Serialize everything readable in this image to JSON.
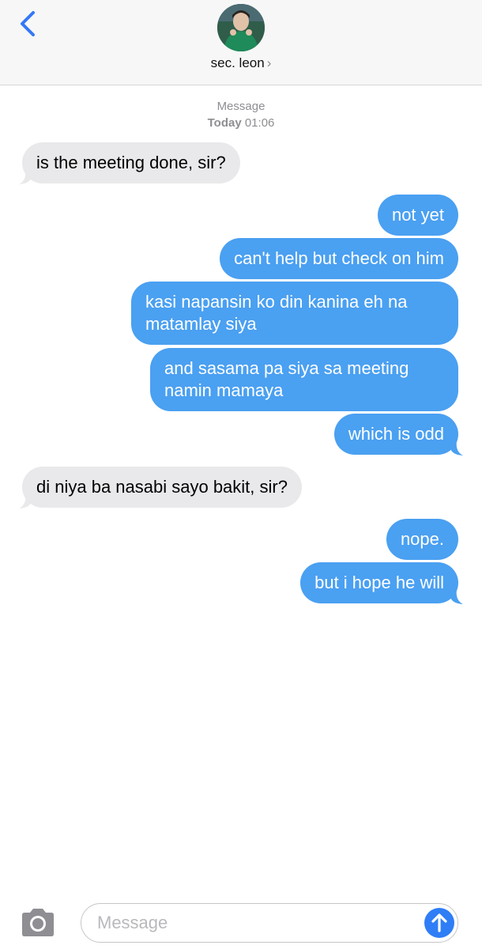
{
  "header": {
    "contact_name": "sec. leon",
    "chevron": "›",
    "back_icon": "chevron-left-icon",
    "accent": "#3478f6"
  },
  "thread": {
    "service_label": "Message",
    "day_label": "Today",
    "time_label": "01:06",
    "messages": [
      {
        "side": "incoming",
        "text": "is the meeting done, sir?"
      },
      {
        "side": "outgoing",
        "text": "not yet"
      },
      {
        "side": "outgoing",
        "text": "can't help but check on him"
      },
      {
        "side": "outgoing",
        "text": "kasi napansin ko din kanina eh na matamlay siya"
      },
      {
        "side": "outgoing",
        "text": "and sasama pa siya sa meeting namin mamaya"
      },
      {
        "side": "outgoing",
        "text": "which is odd"
      },
      {
        "side": "incoming",
        "text": "di niya ba nasabi sayo bakit, sir?"
      },
      {
        "side": "outgoing",
        "text": "nope."
      },
      {
        "side": "outgoing",
        "text": "but i hope he will"
      }
    ],
    "incoming_color": "#e9e9eb",
    "outgoing_color": "#4aa0f1"
  },
  "composer": {
    "placeholder": "Message",
    "camera_icon": "camera-icon",
    "send_icon": "send-arrow-icon",
    "send_color": "#2f7ef6"
  }
}
